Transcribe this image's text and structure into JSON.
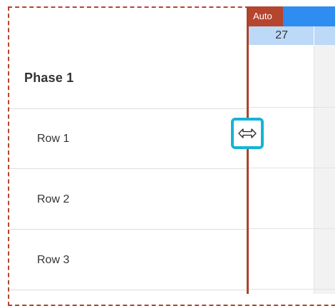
{
  "colors": {
    "accent_red": "#b5452e",
    "timeline_blue": "#2f8cf0",
    "day_row_blue": "#bcd9f7",
    "highlight_cyan": "#14b4d6"
  },
  "grid": {
    "phase_title": "Phase 1",
    "rows": [
      {
        "label": "Row 1"
      },
      {
        "label": "Row 2"
      },
      {
        "label": "Row 3"
      }
    ]
  },
  "timeline": {
    "auto_label": "Auto",
    "day": "27"
  },
  "cursor": {
    "icon": "resize-horizontal-icon"
  }
}
